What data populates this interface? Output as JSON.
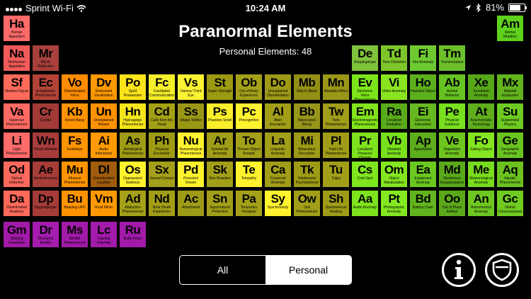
{
  "status_bar": {
    "carrier": "Sprint Wi-Fi",
    "time": "10:24 AM",
    "battery": "81%",
    "battery_level": 0.81,
    "icons": [
      "signal-dots-icon",
      "wifi-icon",
      "location-arrow-icon",
      "bluetooth-icon",
      "battery-icon"
    ]
  },
  "header": {
    "title": "Paranormal Elements",
    "subtitle": "Personal Elements: 48"
  },
  "tabs": [
    {
      "label": "All",
      "selected": false
    },
    {
      "label": "Personal",
      "selected": true
    }
  ],
  "buttons": {
    "info_icon": "info-icon",
    "shield_icon": "shield-icon"
  },
  "rows": [
    [
      {
        "sym": "Ha",
        "name": "Human Apparition",
        "color": "#ff6a6a",
        "col": 0
      },
      {
        "sym": "Am",
        "name": "Animal Mutation",
        "color": "#5fd11d",
        "col": 17
      }
    ],
    [
      {
        "sym": "Na",
        "name": "Nonhuman Apparition",
        "color": "#f25a5a",
        "col": 0
      },
      {
        "sym": "Mr",
        "name": "Mirror Reflection",
        "color": "#a8403b",
        "col": 1
      },
      {
        "sym": "De",
        "name": "Dopplegahger",
        "color": "#7fc23b",
        "col": 12
      },
      {
        "sym": "Td",
        "name": "Time Distortion",
        "color": "#7dc52a",
        "col": 13
      },
      {
        "sym": "Fi",
        "name": "Fire Anomaly",
        "color": "#6ec930",
        "col": 14
      },
      {
        "sym": "Tm",
        "name": "Transmutation",
        "color": "#6cbf2a",
        "col": 15
      }
    ],
    [
      {
        "sym": "Sf",
        "name": "Shadow Figure",
        "color": "#ff6a5a",
        "col": 0
      },
      {
        "sym": "Ec",
        "name": "Ectoplasmic Phenomenon",
        "color": "#b24336",
        "col": 1
      },
      {
        "sym": "Vo",
        "name": "Disembodied Voice",
        "color": "#ff8c00",
        "col": 2
      },
      {
        "sym": "Dv",
        "name": "Distressed Vocalization",
        "color": "#ff9900",
        "col": 3
      },
      {
        "sym": "Po",
        "name": "Spirit Possession",
        "color": "#fbe41a",
        "col": 4
      },
      {
        "sym": "Fc",
        "name": "Facilitated Communication",
        "color": "#f5ee2a",
        "col": 5
      },
      {
        "sym": "Vs",
        "name": "Visions/ Third Eye",
        "color": "#fbf232",
        "col": 6
      },
      {
        "sym": "St",
        "name": "Super Strength",
        "color": "#9c9a12",
        "col": 7
      },
      {
        "sym": "Ob",
        "name": "Out of Body Experience",
        "color": "#a4a01a",
        "col": 8
      },
      {
        "sym": "Do",
        "name": "Unexplained Disorientation",
        "color": "#9e9a18",
        "col": 9
      },
      {
        "sym": "Mb",
        "name": "Man in Black",
        "color": "#928f15",
        "col": 10
      },
      {
        "sym": "Mn",
        "name": "Mandela Effect",
        "color": "#9a9617",
        "col": 11
      },
      {
        "sym": "Ev",
        "name": "Electronic Voice Phenomenon",
        "color": "#7be51a",
        "col": 12
      },
      {
        "sym": "Vi",
        "name": "Video Anomaly",
        "color": "#8ae520",
        "col": 13
      },
      {
        "sym": "Ho",
        "name": "Haunted Object",
        "color": "#5cb01c",
        "col": 14
      },
      {
        "sym": "Ab",
        "name": "Animal Behavior",
        "color": "#65c220",
        "col": 15
      },
      {
        "sym": "Xe",
        "name": "Xenobient Anomaly",
        "color": "#57a818",
        "col": 16
      },
      {
        "sym": "Mx",
        "name": "Material Expansion",
        "color": "#61b41c",
        "col": 17
      }
    ],
    [
      {
        "sym": "Va",
        "name": "Vaporous Phenomenon",
        "color": "#ff6a62",
        "col": 0
      },
      {
        "sym": "Cr",
        "name": "Crystal",
        "color": "#a23b38",
        "col": 1
      },
      {
        "sym": "Kb",
        "name": "Knock Bang",
        "color": "#ff9300",
        "col": 2
      },
      {
        "sym": "Un",
        "name": "Unexplained Noises",
        "color": "#ff9200",
        "col": 3
      },
      {
        "sym": "Hn",
        "name": "Hypnagogic Phenomenon",
        "color": "#f5e61c",
        "col": 4
      },
      {
        "sym": "Cd",
        "name": "Calls from the Dead",
        "color": "#a3a016",
        "col": 5
      },
      {
        "sym": "Ss",
        "name": "Shape Shifter",
        "color": "#9b9715",
        "col": 6
      },
      {
        "sym": "Ps",
        "name": "Phantom Smell",
        "color": "#fbee2a",
        "col": 7
      },
      {
        "sym": "Pc",
        "name": "Precognition",
        "color": "#fff22e",
        "col": 8
      },
      {
        "sym": "Al",
        "name": "Alien Encounter",
        "color": "#a29e18",
        "col": 9
      },
      {
        "sym": "Bb",
        "name": "Black-eyed Being",
        "color": "#97951a",
        "col": 10
      },
      {
        "sym": "Tw",
        "name": "Twin Phenomenon",
        "color": "#a19c19",
        "col": 11
      },
      {
        "sym": "Em",
        "name": "Electromagnetic Phenomenon",
        "color": "#82e41c",
        "col": 12
      },
      {
        "sym": "Ra",
        "name": "Localized Radiation",
        "color": "#5aab1a",
        "col": 13
      },
      {
        "sym": "Ei",
        "name": "Electronic Interaction",
        "color": "#67b91f",
        "col": 14
      },
      {
        "sym": "Pe",
        "name": "Physical Evidence",
        "color": "#78e01e",
        "col": 15
      },
      {
        "sym": "At",
        "name": "Anachronistic Technology",
        "color": "#5fae1c",
        "col": 16
      },
      {
        "sym": "Su",
        "name": "Suspended Physics",
        "color": "#6dcb22",
        "col": 17
      }
    ],
    [
      {
        "sym": "Li",
        "name": "Light Phenomenon",
        "color": "#ff6a6a",
        "col": 0
      },
      {
        "sym": "Wn",
        "name": "Portal Window",
        "color": "#a73c3a",
        "col": 1
      },
      {
        "sym": "Fs",
        "name": "Footsteps",
        "color": "#ff9400",
        "col": 2
      },
      {
        "sym": "Ai",
        "name": "Audio Interaction",
        "color": "#ff9a00",
        "col": 3
      },
      {
        "sym": "As",
        "name": "Astrological Phenomenon",
        "color": "#9f9b16",
        "col": 4
      },
      {
        "sym": "Ph",
        "name": "Physical Encounter",
        "color": "#9e9b15",
        "col": 5
      },
      {
        "sym": "Nu",
        "name": "Numerological Phenomenon",
        "color": "#fff22e",
        "col": 6
      },
      {
        "sym": "Ar",
        "name": "Sensed Air Anomaly",
        "color": "#a19d18",
        "col": 7
      },
      {
        "sym": "To",
        "name": "Thrown Object Assault",
        "color": "#a3a019",
        "col": 8
      },
      {
        "sym": "La",
        "name": "Linguistic Anomaly",
        "color": "#a19e18",
        "col": 9
      },
      {
        "sym": "Mi",
        "name": "Miraculous Encounter",
        "color": "#9d9a17",
        "col": 10
      },
      {
        "sym": "Pl",
        "name": "Past Life Phenomenon",
        "color": "#a19c18",
        "col": 11
      },
      {
        "sym": "Pr",
        "name": "Localized Pressure Change",
        "color": "#7ee21d",
        "col": 12
      },
      {
        "sym": "Vb",
        "name": "Vibration Anomaly",
        "color": "#79e01c",
        "col": 13
      },
      {
        "sym": "Ap",
        "name": "Apportation",
        "color": "#5cae1b",
        "col": 14
      },
      {
        "sym": "Ve",
        "name": "Vegetation Anomaly",
        "color": "#6ec51f",
        "col": 15
      },
      {
        "sym": "Fo",
        "name": "Falling Object",
        "color": "#83e620",
        "col": 16
      },
      {
        "sym": "Ge",
        "name": "Geographic Anomaly",
        "color": "#6ac420",
        "col": 17
      }
    ],
    [
      {
        "sym": "Od",
        "name": "Optical Distortion",
        "color": "#ff6a5e",
        "col": 0
      },
      {
        "sym": "Ae",
        "name": "Aerial Anomaly",
        "color": "#a63d39",
        "col": 1
      },
      {
        "sym": "Mu",
        "name": "Musical Phenomenon",
        "color": "#ff9400",
        "col": 2
      },
      {
        "sym": "Dl",
        "name": "Disembodied Laughter",
        "color": "#a05c0c",
        "col": 3
      },
      {
        "sym": "Os",
        "name": "Oppression/ Sadness",
        "color": "#fff22e",
        "col": 4
      },
      {
        "sym": "Sx",
        "name": "Sexual Contact",
        "color": "#a4a019",
        "col": 5
      },
      {
        "sym": "Pd",
        "name": "Prescient Dream",
        "color": "#fff22e",
        "col": 6
      },
      {
        "sym": "Sk",
        "name": "Skin Reaction",
        "color": "#a39f18",
        "col": 7
      },
      {
        "sym": "Te",
        "name": "Telepathy",
        "color": "#fff22e",
        "col": 8
      },
      {
        "sym": "Ca",
        "name": "Corporeal Anomaly",
        "color": "#a29e18",
        "col": 9
      },
      {
        "sym": "Tk",
        "name": "Telekinesis/ Psychokinesis",
        "color": "#9e9b16",
        "col": 10
      },
      {
        "sym": "Tu",
        "name": "Tulpa",
        "color": "#a29e18",
        "col": 11
      },
      {
        "sym": "Cs",
        "name": "Cold Spot",
        "color": "#7fe61d",
        "col": 12
      },
      {
        "sym": "Om",
        "name": "Object Manipulation",
        "color": "#84e620",
        "col": 13
      },
      {
        "sym": "Ea",
        "name": "Equipment Anomaly",
        "color": "#6ac81f",
        "col": 14
      },
      {
        "sym": "Md",
        "name": "Mysterious Disappearance",
        "color": "#5aa91a",
        "col": 15
      },
      {
        "sym": "Me",
        "name": "Meteorological Anomaly",
        "color": "#78dc1d",
        "col": 16
      },
      {
        "sym": "Aq",
        "name": "Aquatic Phenomenon",
        "color": "#6cc31f",
        "col": 17
      }
    ],
    [
      {
        "sym": "Da",
        "name": "Disembodied Anatomy",
        "color": "#ff6a5a",
        "col": 0
      },
      {
        "sym": "Dp",
        "name": "Doppelganger",
        "color": "#a63c38",
        "col": 1
      },
      {
        "sym": "Bu",
        "name": "Beeping UFO",
        "color": "#ff9400",
        "col": 2
      },
      {
        "sym": "Vm",
        "name": "Vocal Mimic",
        "color": "#ff9a00",
        "col": 3
      },
      {
        "sym": "Ad",
        "name": "Abduction Phenomenon",
        "color": "#a4a019",
        "col": 4
      },
      {
        "sym": "Nd",
        "name": "Near Death Experience",
        "color": "#a29e18",
        "col": 5
      },
      {
        "sym": "Ac",
        "name": "Attachment",
        "color": "#9e9b17",
        "col": 6
      },
      {
        "sym": "Sn",
        "name": "Supernatural Protection",
        "color": "#a29e18",
        "col": 7
      },
      {
        "sym": "Pa",
        "name": "Temporary Paralysis",
        "color": "#a4a019",
        "col": 8
      },
      {
        "sym": "Sy",
        "name": "Synchronicity",
        "color": "#fff22e",
        "col": 9
      },
      {
        "sym": "Ow",
        "name": "Owl Phenomenon",
        "color": "#a29e18",
        "col": 10
      },
      {
        "sym": "Sh",
        "name": "Spontaneous Healing",
        "color": "#9f9b17",
        "col": 11
      },
      {
        "sym": "Aa",
        "name": "Audio Anomaly",
        "color": "#7ee21d",
        "col": 12
      },
      {
        "sym": "Pt",
        "name": "Photographic Anomaly",
        "color": "#84e820",
        "col": 13
      },
      {
        "sym": "Bd",
        "name": "Battery Drain",
        "color": "#62b51d",
        "col": 14
      },
      {
        "sym": "Oo",
        "name": "Out of Place Artifact",
        "color": "#5ba91a",
        "col": 15
      },
      {
        "sym": "An",
        "name": "Astronomical Anomaly",
        "color": "#6ec720",
        "col": 16
      },
      {
        "sym": "Gc",
        "name": "Global Consciousness",
        "color": "#70cb21",
        "col": 17
      }
    ],
    [
      {
        "sym": "Gm",
        "name": "Glowing Guardians",
        "color": "#a21aa8",
        "col": 0
      },
      {
        "sym": "Dr",
        "name": "Divergent Reality",
        "color": "#a51cae",
        "col": 1
      },
      {
        "sym": "Ms",
        "name": "Morbid Phenomenon",
        "color": "#a21aa8",
        "col": 2
      },
      {
        "sym": "Lc",
        "name": "Lapsing Claiming",
        "color": "#a31baa",
        "col": 3
      },
      {
        "sym": "Ru",
        "name": "Ruby Fears",
        "color": "#a11aa8",
        "col": 4
      }
    ]
  ]
}
